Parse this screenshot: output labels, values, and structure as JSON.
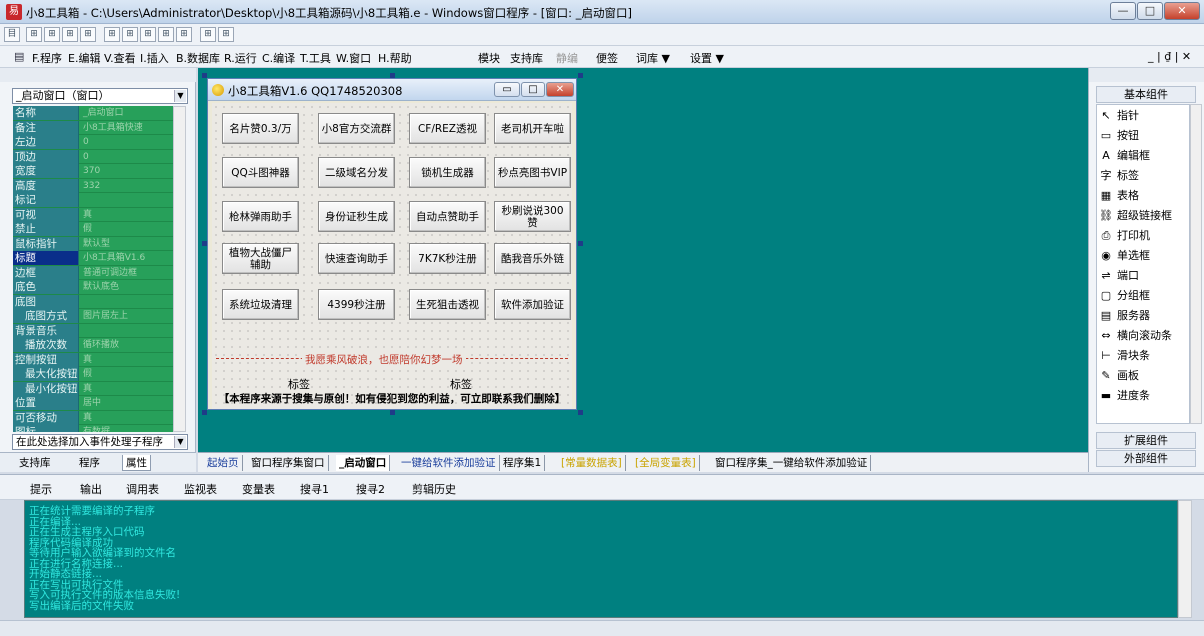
{
  "window": {
    "title": "小8工具箱 - C:\\Users\\Administrator\\Desktop\\小8工具箱源码\\小8工具箱.e - Windows窗口程序 - [窗口: _启动窗口]",
    "icon_char": "易",
    "minimize": "—",
    "maximize": "□",
    "close": "✕"
  },
  "toolbar": {
    "items": [
      "目",
      "⊞",
      "⊞",
      "⊞",
      "⊞",
      "⊞",
      "⊞",
      "⊞",
      "⊞",
      "⊞",
      "⊞",
      "⊞"
    ]
  },
  "menu": {
    "items": [
      {
        "key": "F",
        "label": "F.程序"
      },
      {
        "key": "E",
        "label": "E.编辑"
      },
      {
        "key": "V",
        "label": "V.查看"
      },
      {
        "key": "I",
        "label": "I.插入"
      },
      {
        "key": "B",
        "label": "B.数据库"
      },
      {
        "key": "R",
        "label": "R.运行"
      },
      {
        "key": "C",
        "label": "C.编译"
      },
      {
        "key": "T",
        "label": "T.工具"
      },
      {
        "key": "W",
        "label": "W.窗口"
      },
      {
        "key": "H",
        "label": "H.帮助"
      }
    ],
    "right_items": [
      "模块",
      "支持库",
      "静编",
      "便签",
      "词库 ▼",
      "设置 ▼"
    ],
    "mdi": "_ | ₫ | ✕"
  },
  "left_panel": {
    "combo": "_启动窗口（窗口）",
    "combo2": "在此处选择加入事件处理子程序",
    "props": [
      {
        "name": "名称",
        "val": "_启动窗口"
      },
      {
        "name": "备注",
        "val": "小8工具箱快速"
      },
      {
        "name": "左边",
        "val": "0"
      },
      {
        "name": "顶边",
        "val": "0"
      },
      {
        "name": "宽度",
        "val": "370"
      },
      {
        "name": "高度",
        "val": "332"
      },
      {
        "name": "标记",
        "val": ""
      },
      {
        "name": "可视",
        "val": "真"
      },
      {
        "name": "禁止",
        "val": "假"
      },
      {
        "name": "鼠标指针",
        "val": "默认型"
      },
      {
        "name": "标题",
        "val": "小8工具箱V1.6",
        "sel": true
      },
      {
        "name": "边框",
        "val": "普通可调边框"
      },
      {
        "name": "底色",
        "val": "默认底色"
      },
      {
        "name": "底图",
        "val": ""
      },
      {
        "name": "底图方式",
        "val": "图片居左上",
        "ind": true
      },
      {
        "name": "背景音乐",
        "val": ""
      },
      {
        "name": "播放次数",
        "val": "循环播放",
        "ind": true
      },
      {
        "name": "控制按钮",
        "val": "真"
      },
      {
        "name": "最大化按钮",
        "val": "假",
        "ind": true
      },
      {
        "name": "最小化按钮",
        "val": "真",
        "ind": true
      },
      {
        "name": "位置",
        "val": "居中"
      },
      {
        "name": "可否移动",
        "val": "真"
      },
      {
        "name": "图标",
        "val": "有数据"
      }
    ],
    "tabs": [
      "支持库",
      "程序",
      "属性"
    ]
  },
  "form": {
    "title": "小8工具箱V1.6  QQ1748520308",
    "min": "▭",
    "max": "□",
    "close": "✕",
    "buttons": [
      [
        "名片赞0.3/万",
        "小8官方交流群",
        "CF/REZ透视",
        "老司机开车啦"
      ],
      [
        "QQ斗图神器",
        "二级域名分发",
        "锁机生成器",
        "秒点亮图书VIP"
      ],
      [
        "枪林弹雨助手",
        "身份证秒生成",
        "自动点赞助手",
        "秒刷说说300赞"
      ],
      [
        "植物大战僵尸辅助",
        "快速查询助手",
        "7K7K秒注册",
        "酷我音乐外链"
      ],
      [
        "系统垃圾清理",
        "4399秒注册",
        "生死狙击透视",
        "软件添加验证"
      ]
    ],
    "red_text": "我愿乘风破浪，也愿陪你幻梦一场",
    "label1": "标签",
    "label2": "标签",
    "notice": "【本程序来源于搜集与原创！如有侵犯到您的利益，可立即联系我们删除】"
  },
  "right_panel": {
    "basic": "基本组件",
    "ext": "扩展组件",
    "ext2": "外部组件",
    "items": [
      {
        "icon": "↖",
        "label": "指针"
      },
      {
        "icon": "▭",
        "label": "按钮"
      },
      {
        "icon": "A",
        "label": "编辑框"
      },
      {
        "icon": "字",
        "label": "标签"
      },
      {
        "icon": "▦",
        "label": "表格"
      },
      {
        "icon": "⛓",
        "label": "超级链接框"
      },
      {
        "icon": "⎙",
        "label": "打印机"
      },
      {
        "icon": "◉",
        "label": "单选框"
      },
      {
        "icon": "⇌",
        "label": "端口"
      },
      {
        "icon": "▢",
        "label": "分组框"
      },
      {
        "icon": "▤",
        "label": "服务器"
      },
      {
        "icon": "⇔",
        "label": "横向滚动条"
      },
      {
        "icon": "⊢",
        "label": "滑块条"
      },
      {
        "icon": "✎",
        "label": "画板"
      },
      {
        "icon": "▬",
        "label": "进度条"
      }
    ]
  },
  "doc_tabs": [
    {
      "label": "起始页",
      "style": "blue"
    },
    {
      "label": "窗口程序集窗口",
      "style": ""
    },
    {
      "label": "_启动窗口",
      "style": "active"
    },
    {
      "label": "一键给软件添加验证",
      "style": "blue"
    },
    {
      "label": "程序集1",
      "style": ""
    },
    {
      "label": "[常量数据表]",
      "style": "yellow"
    },
    {
      "label": "[全局变量表]",
      "style": "yellow"
    },
    {
      "label": "窗口程序集_一键给软件添加验证",
      "style": ""
    }
  ],
  "bottom_tabs": [
    "提示",
    "输出",
    "调用表",
    "监视表",
    "变量表",
    "搜寻1",
    "搜寻2",
    "剪辑历史"
  ],
  "output_lines": [
    "正在统计需要编译的子程序",
    "正在编译...",
    "正在生成主程序入口代码",
    "程序代码编译成功",
    "等待用户输入欲编译到的文件名",
    "正在进行名称连接...",
    "开始静态链接...",
    "正在写出可执行文件",
    "写入可执行文件的版本信息失败!",
    "写出编译后的文件失败"
  ]
}
